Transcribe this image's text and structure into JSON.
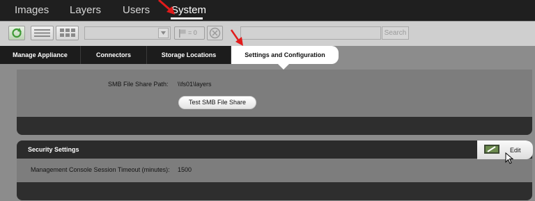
{
  "nav": {
    "items": [
      {
        "label": "Images"
      },
      {
        "label": "Layers"
      },
      {
        "label": "Users"
      },
      {
        "label": "System"
      }
    ]
  },
  "toolbar": {
    "filter_count": "= 0",
    "search_button": "Search",
    "search_placeholder": ""
  },
  "tabs": [
    {
      "label": "Manage Appliance"
    },
    {
      "label": "Connectors"
    },
    {
      "label": "Storage Locations"
    },
    {
      "label": "Settings and Configuration"
    }
  ],
  "smb": {
    "path_label": "SMB File Share Path:",
    "path_value": "\\\\fs01\\layers",
    "test_button": "Test SMB File Share"
  },
  "security": {
    "title": "Security Settings",
    "edit_label": "Edit",
    "timeout_label": "Management Console Session Timeout (minutes):",
    "timeout_value": "1500"
  },
  "colors": {
    "nav_bg": "#1f1f1f",
    "toolbar_bg": "#cfcfcf",
    "tab_bg": "#1c1c1c",
    "panel_bg": "#7d7d7d",
    "annotation_arrow": "#e11b1b"
  }
}
